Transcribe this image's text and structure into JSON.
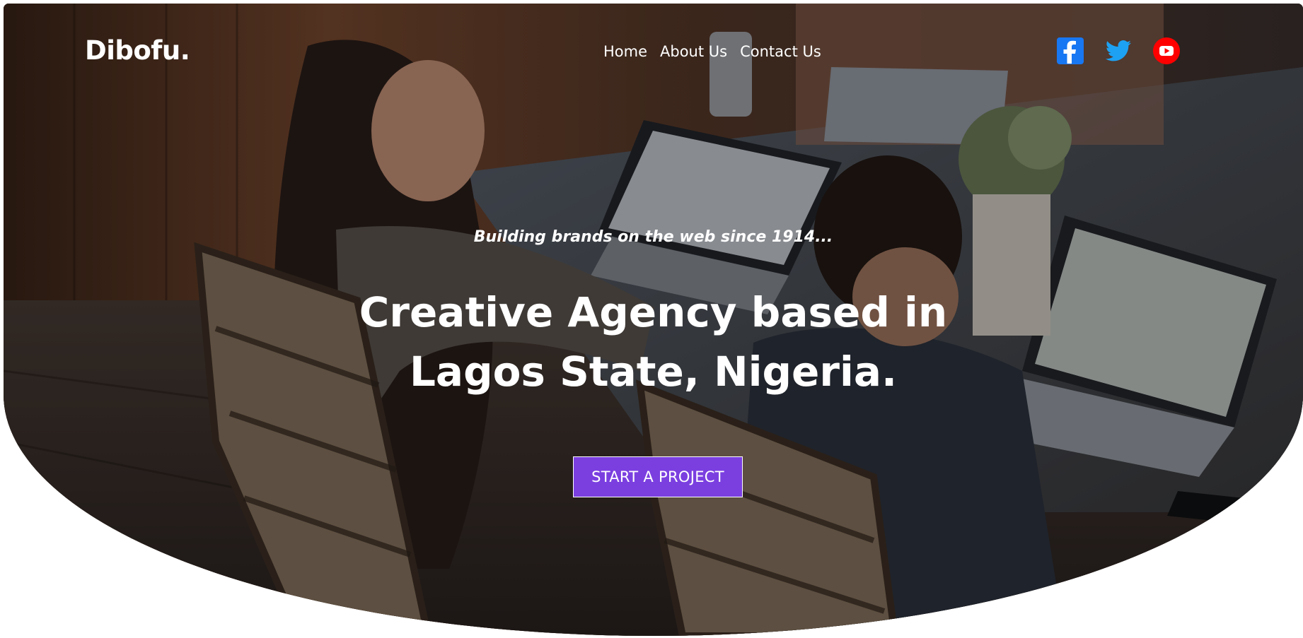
{
  "header": {
    "brand": "Dibofu.",
    "nav": [
      {
        "label": "Home"
      },
      {
        "label": "About Us"
      },
      {
        "label": "Contact Us"
      }
    ],
    "socials": [
      {
        "icon": "facebook-icon",
        "color": "#1877f2"
      },
      {
        "icon": "twitter-icon",
        "color": "#1da1f2"
      },
      {
        "icon": "youtube-icon",
        "color": "#ff0000"
      }
    ]
  },
  "hero": {
    "tagline": "Building brands on the web since 1914...",
    "headline_line1": "Creative Agency based in",
    "headline_line2": "Lagos State, Nigeria.",
    "cta_label": "START A PROJECT",
    "cta_color": "#7b3fe0"
  }
}
